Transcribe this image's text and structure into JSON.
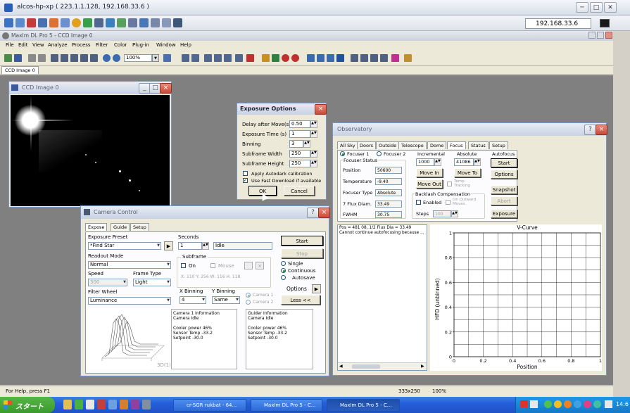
{
  "vnc": {
    "title": "alcos-hp-xp ( 223.1.1.128, 192.168.33.6 )",
    "address": "192.168.33.6",
    "minimize": "─",
    "maximize": "□",
    "close": "✕"
  },
  "maxim": {
    "title": "MaxIm DL Pro 5 - CCD Image 0",
    "menu": [
      "File",
      "Edit",
      "View",
      "Analyze",
      "Process",
      "Filter",
      "Color",
      "Plug-in",
      "Window",
      "Help"
    ],
    "zoom": "100%",
    "doc_tab": "CCD Image 0"
  },
  "ccd_window": {
    "title": "CCD Image 0"
  },
  "exposure_options": {
    "title": "Exposure Options",
    "rows": [
      {
        "label": "Delay after Move(s)",
        "value": "0.50"
      },
      {
        "label": "Exposure Time (s)",
        "value": "1"
      },
      {
        "label": "Binning",
        "value": "3"
      },
      {
        "label": "Subframe Width",
        "value": "250"
      },
      {
        "label": "Subframe Height",
        "value": "250"
      }
    ],
    "check_autodark": "Apply Autodark calibration",
    "check_fast": "Use Fast Download if available",
    "ok": "OK",
    "cancel": "Cancel"
  },
  "camera_control": {
    "title": "Camera Control",
    "tabs": [
      "Expose",
      "Guide",
      "Setup"
    ],
    "exposure_preset_label": "Exposure Preset",
    "exposure_preset": "*Find Star",
    "readout_mode_label": "Readout Mode",
    "readout_mode": "Normal",
    "speed_label": "Speed",
    "speed": "300",
    "frame_type_label": "Frame Type",
    "frame_type": "Light",
    "filter_wheel_label": "Filter Wheel",
    "filter_wheel": "Luminance",
    "seconds_label": "Seconds",
    "seconds": "1",
    "status": "Idle",
    "subframe_label": "Subframe",
    "subframe_on": "On",
    "subframe_mouse": "Mouse",
    "subframe_info": "X: 110 Y: 256 W: 116 H: 118",
    "single": "Single",
    "continuous": "Continuous",
    "autosave": "Autosave",
    "options": "Options",
    "less": "Less <<",
    "start": "Start",
    "stop": "Stop",
    "xbin_label": "X Binning",
    "xbin": "4",
    "ybin_label": "Y Binning",
    "ybin": "Same",
    "camera1": "Camera 1",
    "camera2": "Camera 2",
    "cam_info": [
      "Camera 1 Information",
      "Camera Idle",
      "",
      "Cooler power 46%",
      "Sensor Temp -33.2",
      "Setpoint -30.0"
    ],
    "guider_info": [
      "Guider Information",
      "Camera Idle",
      "",
      "Cooler power 46%",
      "Sensor Temp -33.2",
      "Setpoint -30.0"
    ],
    "graph_label": "3D(1)"
  },
  "observatory": {
    "title": "Observatory",
    "tabs": [
      "All Sky",
      "Doors",
      "Outside",
      "Telescope",
      "Dome",
      "Focus",
      "Status",
      "Setup"
    ],
    "focuser1": "Focuser 1",
    "focuser2": "Focuser 2",
    "focuser_status": "Focuser Status",
    "position_label": "Position",
    "position": "50600",
    "temperature_label": "Temperature",
    "temperature": "-9.40",
    "focuser_type_label": "Focuser Type",
    "focuser_type": "Absolute",
    "flux_label": "7 Flux Diam.",
    "flux": "33.49",
    "fwhm_label": "FWHM",
    "fwhm": "30.75",
    "incremental_label": "Incremental",
    "incremental": "1000",
    "move_in": "Move In",
    "move_out": "Move Out",
    "temp_tracking": "Temp. Tracking",
    "absolute_label": "Absolute",
    "absolute": "41086",
    "move_to": "Move To",
    "autofocus_label": "Autofocus",
    "af_start": "Start",
    "af_options": "Options",
    "snapshot": "Snapshot",
    "abort": "Abort",
    "exposure": "Exposure",
    "backlash_label": "Backlash Compensation",
    "enabled": "Enabled",
    "on_outward": "On Outward Moves",
    "steps_label": "Steps",
    "steps": "100",
    "log": "Pos = 481 08, 1/2 Flux Dia = 33.49 Cannot continue autofocusing because ..."
  },
  "chart_data": {
    "type": "scatter",
    "title": "V-Curve",
    "xlabel": "Position",
    "ylabel": "HFD (unbinned)",
    "xlim": [
      0,
      1
    ],
    "ylim": [
      0,
      1
    ],
    "x_ticks": [
      "0",
      "0.2",
      "0.4",
      "0.6",
      "0.8",
      "1"
    ],
    "y_ticks": [
      "0",
      "0.2",
      "0.4",
      "0.6",
      "0.8",
      "1"
    ],
    "points": []
  },
  "statusbar": {
    "help": "For Help, press F1",
    "coords": "333x250",
    "zoom": "100%"
  },
  "taskbar": {
    "start": "スタート",
    "tasks": [
      "cr-SGR rukbat - 64...",
      "MaxIm DL Pro 5 - C...",
      "MaxIm DL Pro 5 - C..."
    ],
    "clock": "14:6"
  }
}
